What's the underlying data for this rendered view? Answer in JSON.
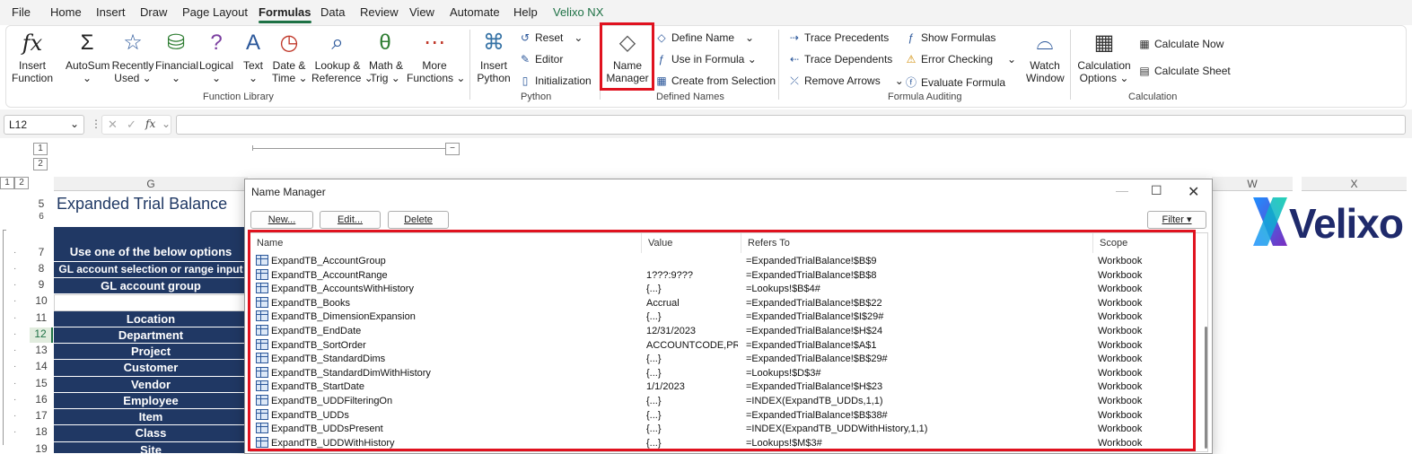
{
  "menu": [
    "File",
    "Home",
    "Insert",
    "Draw",
    "Page Layout",
    "Formulas",
    "Data",
    "Review",
    "View",
    "Automate",
    "Help",
    "Velixo NX"
  ],
  "ribbon": {
    "insert_function": {
      "l1": "Insert",
      "l2": "Function"
    },
    "autosum": {
      "l1": "AutoSum",
      "l2": "⌄"
    },
    "recently_used": {
      "l1": "Recently",
      "l2": "Used ⌄"
    },
    "financial": {
      "l1": "Financial",
      "l2": "⌄"
    },
    "logical": {
      "l1": "Logical",
      "l2": "⌄"
    },
    "text": {
      "l1": "Text",
      "l2": "⌄"
    },
    "date_time": {
      "l1": "Date &",
      "l2": "Time ⌄"
    },
    "lookup_reference": {
      "l1": "Lookup &",
      "l2": "Reference ⌄"
    },
    "math_trig": {
      "l1": "Math &",
      "l2": "Trig ⌄"
    },
    "more_functions": {
      "l1": "More",
      "l2": "Functions ⌄"
    },
    "function_library_label": "Function Library",
    "insert_python": {
      "l1": "Insert",
      "l2": "Python"
    },
    "reset": "Reset",
    "editor": "Editor",
    "initialization": "Initialization",
    "python_label": "Python",
    "name_manager": {
      "l1": "Name",
      "l2": "Manager"
    },
    "define_name": "Define Name",
    "use_in_formula": "Use in Formula ⌄",
    "create_from_selection": "Create from Selection",
    "defined_names_label": "Defined Names",
    "trace_precedents": "Trace Precedents",
    "trace_dependents": "Trace Dependents",
    "remove_arrows": "Remove Arrows",
    "show_formulas": "Show Formulas",
    "error_checking": "Error Checking",
    "evaluate_formula": "Evaluate Formula",
    "watch_window": {
      "l1": "Watch",
      "l2": "Window"
    },
    "formula_auditing_label": "Formula Auditing",
    "calculation_options": {
      "l1": "Calculation",
      "l2": "Options ⌄"
    },
    "calculate_now": "Calculate Now",
    "calculate_sheet": "Calculate Sheet",
    "calculation_label": "Calculation"
  },
  "formula_bar": {
    "name_box": "L12",
    "fx": "fx"
  },
  "outline": {
    "levels_top": [
      "1",
      "2"
    ],
    "levels_left": [
      "1",
      "2"
    ],
    "collapse": "−"
  },
  "columns": {
    "g": "G",
    "w": "W",
    "x": "X"
  },
  "sheet": {
    "title": "Expanded Trial Balance",
    "rows": [
      {
        "num": "5",
        "text": ""
      },
      {
        "num": "6",
        "text": ""
      },
      {
        "num": "7",
        "text": "Use one of the below options"
      },
      {
        "num": "8",
        "text": "GL account selection or range input"
      },
      {
        "num": "9",
        "text": "GL account group"
      },
      {
        "num": "10",
        "text": ""
      },
      {
        "num": "11",
        "text": "Location"
      },
      {
        "num": "12",
        "text": "Department"
      },
      {
        "num": "13",
        "text": "Project"
      },
      {
        "num": "14",
        "text": "Customer"
      },
      {
        "num": "15",
        "text": "Vendor"
      },
      {
        "num": "16",
        "text": "Employee"
      },
      {
        "num": "17",
        "text": "Item"
      },
      {
        "num": "18",
        "text": "Class"
      },
      {
        "num": "19",
        "text": "Site"
      }
    ]
  },
  "logo": "Velixo",
  "dialog": {
    "title": "Name Manager",
    "buttons": {
      "new": "New...",
      "edit": "Edit...",
      "delete": "Delete",
      "filter": "Filter ▾"
    },
    "headers": {
      "name": "Name",
      "value": "Value",
      "refers_to": "Refers To",
      "scope": "Scope"
    },
    "rows": [
      {
        "name": "ExpandTB_AccountGroup",
        "value": "",
        "refers": "=ExpandedTrialBalance!$B$9",
        "scope": "Workbook"
      },
      {
        "name": "ExpandTB_AccountRange",
        "value": "1???:9???",
        "refers": "=ExpandedTrialBalance!$B$8",
        "scope": "Workbook"
      },
      {
        "name": "ExpandTB_AccountsWithHistory",
        "value": "{...}",
        "refers": "=Lookups!$B$4#",
        "scope": "Workbook"
      },
      {
        "name": "ExpandTB_Books",
        "value": "Accrual",
        "refers": "=ExpandedTrialBalance!$B$22",
        "scope": "Workbook"
      },
      {
        "name": "ExpandTB_DimensionExpansion",
        "value": "{...}",
        "refers": "=ExpandedTrialBalance!$I$29#",
        "scope": "Workbook"
      },
      {
        "name": "ExpandTB_EndDate",
        "value": "12/31/2023",
        "refers": "=ExpandedTrialBalance!$H$24",
        "scope": "Workbook"
      },
      {
        "name": "ExpandTB_SortOrder",
        "value": "ACCOUNTCODE,PR...",
        "refers": "=ExpandedTrialBalance!$A$1",
        "scope": "Workbook"
      },
      {
        "name": "ExpandTB_StandardDims",
        "value": "{...}",
        "refers": "=ExpandedTrialBalance!$B$29#",
        "scope": "Workbook"
      },
      {
        "name": "ExpandTB_StandardDimWithHistory",
        "value": "{...}",
        "refers": "=Lookups!$D$3#",
        "scope": "Workbook"
      },
      {
        "name": "ExpandTB_StartDate",
        "value": "1/1/2023",
        "refers": "=ExpandedTrialBalance!$H$23",
        "scope": "Workbook"
      },
      {
        "name": "ExpandTB_UDDFilteringOn",
        "value": "{...}",
        "refers": "=INDEX(ExpandTB_UDDs,1,1)",
        "scope": "Workbook"
      },
      {
        "name": "ExpandTB_UDDs",
        "value": "{...}",
        "refers": "=ExpandedTrialBalance!$B$38#",
        "scope": "Workbook"
      },
      {
        "name": "ExpandTB_UDDsPresent",
        "value": "{...}",
        "refers": "=INDEX(ExpandTB_UDDWithHistory,1,1)",
        "scope": "Workbook"
      },
      {
        "name": "ExpandTB_UDDWithHistory",
        "value": "{...}",
        "refers": "=Lookups!$M$3#",
        "scope": "Workbook"
      }
    ]
  },
  "colors": {
    "accent_green": "#1e7145",
    "header_navy": "#203864",
    "highlight_red": "#e0121f",
    "sheet_title_blue": "#1f3864"
  }
}
